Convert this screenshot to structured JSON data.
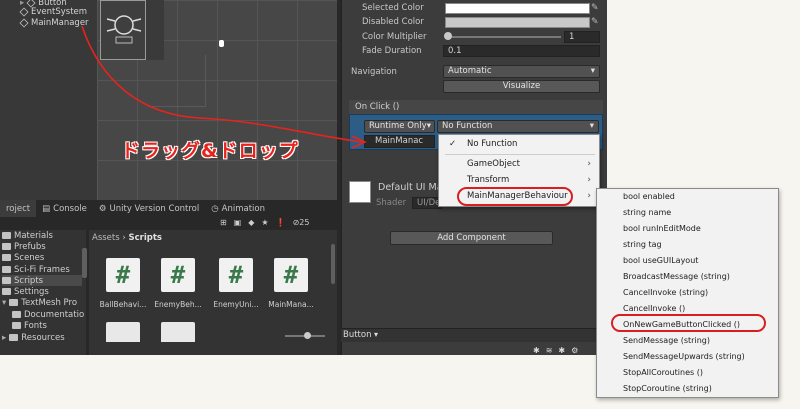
{
  "hierarchy": {
    "items": [
      "Button",
      "EventSystem",
      "MainManager"
    ]
  },
  "inspector": {
    "selected_color_label": "Selected Color",
    "disabled_color_label": "Disabled Color",
    "color_multiplier_label": "Color Multiplier",
    "color_multiplier_value": "1",
    "fade_duration_label": "Fade Duration",
    "fade_duration_value": "0.1",
    "navigation_label": "Navigation",
    "navigation_value": "Automatic",
    "visualize_label": "Visualize",
    "on_click_label": "On Click ()",
    "runtime_only": "Runtime Only",
    "no_function": "No Function",
    "object_field": "MainManac",
    "material_name": "Default UI Ma",
    "shader_label": "Shader",
    "shader_value": "UI/De",
    "add_component": "Add Component",
    "footer_button": "Button"
  },
  "bottom_tabs": [
    "roject",
    "Console",
    "Unity Version Control",
    "Animation"
  ],
  "toolbar_count": "25",
  "breadcrumb": {
    "root": "Assets",
    "current": "Scripts"
  },
  "project_tree": [
    "Materials",
    "Prefubs",
    "Scenes",
    "Sci-Fi Frames",
    "Scripts",
    "Settings",
    "TextMesh Pro",
    "Documentatio",
    "Fonts",
    "Resources"
  ],
  "assets": [
    "BallBehavi...",
    "EnemyBeh...",
    "EnemyUni...",
    "MainMana..."
  ],
  "function_menu": {
    "items": [
      "No Function",
      "GameObject",
      "Transform",
      "MainManagerBehaviour"
    ],
    "checkmark": "✓"
  },
  "member_menu": {
    "items": [
      "bool enabled",
      "string name",
      "bool runInEditMode",
      "string tag",
      "bool useGUILayout",
      "BroadcastMessage (string)",
      "CancelInvoke (string)",
      "CancelInvoke ()",
      "OnNewGameButtonClicked ()",
      "SendMessage (string)",
      "SendMessageUpwards (string)",
      "StopAllCoroutines ()",
      "StopCoroutine (string)"
    ]
  },
  "annotation": {
    "text": "ドラッグ&ドロップ"
  },
  "colors": {
    "accent_red": "#e8231d",
    "selection_blue": "#2c5d87",
    "script_green": "#3a7a4a"
  }
}
